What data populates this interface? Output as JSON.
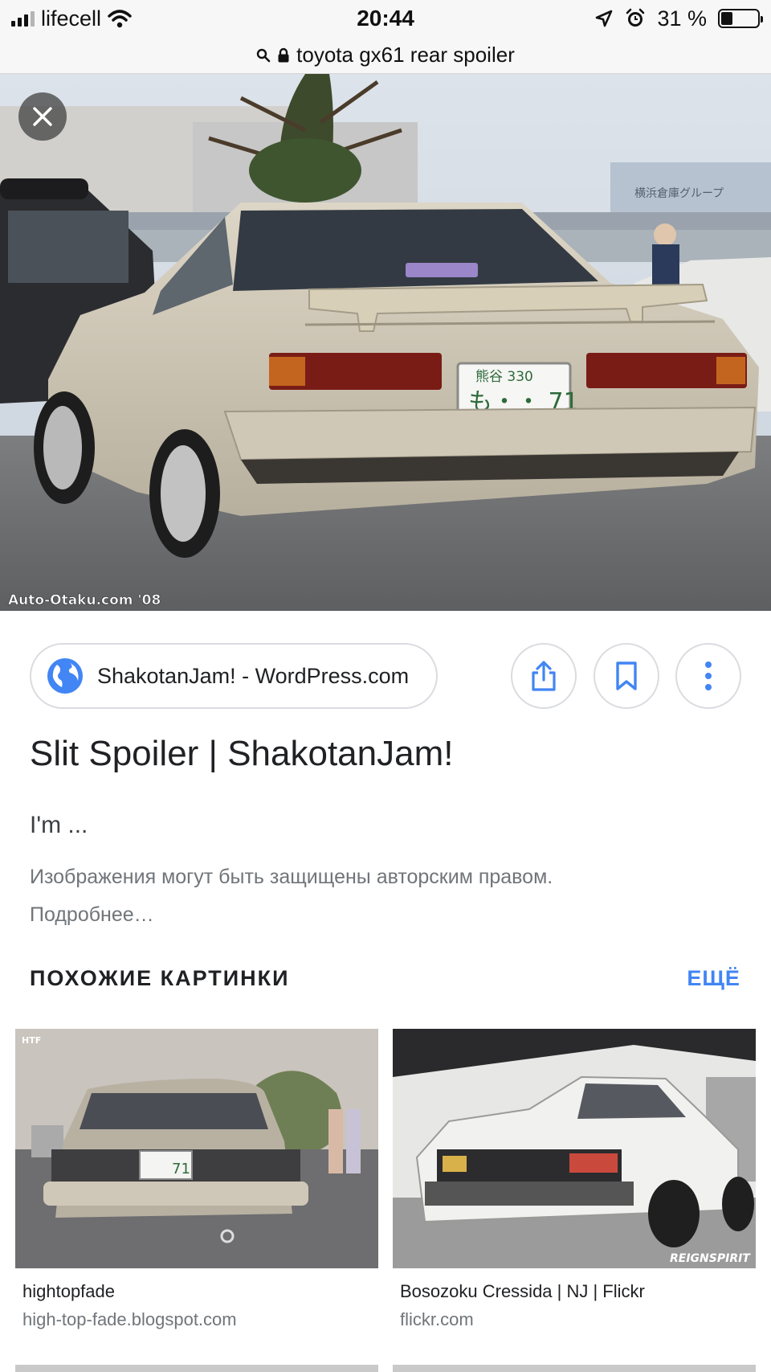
{
  "status_bar": {
    "carrier": "lifecell",
    "time": "20:44",
    "battery_text": "31 %",
    "battery_level": 0.31
  },
  "url_bar": {
    "query": "toyota gx61 rear spoiler"
  },
  "hero": {
    "watermark": "Auto-Otaku.com '08",
    "plate_line1": "熊谷 330",
    "plate_line2": "も・・ 71",
    "sign_text": "横浜倉庫グループ"
  },
  "result": {
    "source": "ShakotanJam! - WordPress.com",
    "title": "Slit Spoiler | ShakotanJam!",
    "snippet": "I'm ...",
    "copyright": "Изображения могут быть защищены авторским правом. Подробнее…"
  },
  "similar": {
    "header": "ПОХОЖИЕ КАРТИНКИ",
    "more": "ЕЩЁ",
    "items": [
      {
        "title": "hightopfade",
        "domain": "high-top-fade.blogspot.com",
        "plate": "71",
        "mark": "HTF"
      },
      {
        "title": "Bosozoku Cressida | NJ | Flickr",
        "domain": "flickr.com",
        "mark": "REIGNSPIRIT"
      }
    ]
  },
  "colors": {
    "accent": "#4285f4",
    "border": "#dadce0",
    "text": "#202124",
    "muted": "#70757a"
  }
}
